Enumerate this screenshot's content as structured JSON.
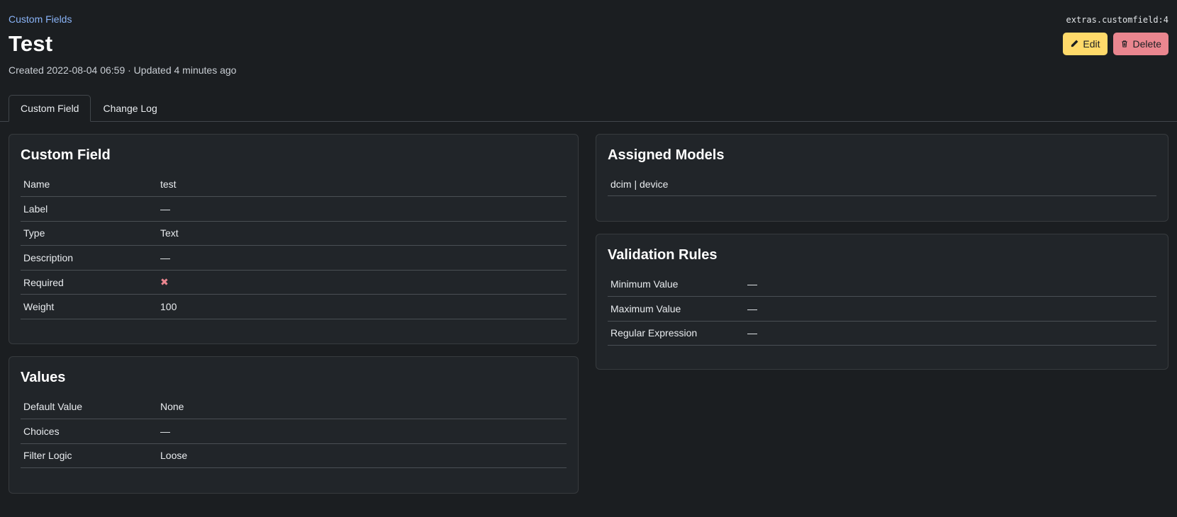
{
  "breadcrumb": "Custom Fields",
  "title": "Test",
  "meta": "Created 2022-08-04 06:59 · Updated 4 minutes ago",
  "object_id": "extras.customfield:4",
  "buttons": {
    "edit": "Edit",
    "delete": "Delete"
  },
  "tabs": [
    {
      "label": "Custom Field",
      "active": true
    },
    {
      "label": "Change Log",
      "active": false
    }
  ],
  "custom_field": {
    "title": "Custom Field",
    "rows": [
      {
        "key": "Name",
        "value": "test"
      },
      {
        "key": "Label",
        "value": "—"
      },
      {
        "key": "Type",
        "value": "Text"
      },
      {
        "key": "Description",
        "value": "—"
      },
      {
        "key": "Required",
        "value": "✖"
      },
      {
        "key": "Weight",
        "value": "100"
      }
    ]
  },
  "values": {
    "title": "Values",
    "rows": [
      {
        "key": "Default Value",
        "value": "None"
      },
      {
        "key": "Choices",
        "value": "—"
      },
      {
        "key": "Filter Logic",
        "value": "Loose"
      }
    ]
  },
  "assigned_models": {
    "title": "Assigned Models",
    "items": [
      "dcim | device"
    ]
  },
  "validation_rules": {
    "title": "Validation Rules",
    "rows": [
      {
        "key": "Minimum Value",
        "value": "—"
      },
      {
        "key": "Maximum Value",
        "value": "—"
      },
      {
        "key": "Regular Expression",
        "value": "—"
      }
    ]
  },
  "colors": {
    "edit": "#ffda6a",
    "delete": "#ea868f",
    "link": "#8ab4f8",
    "false_icon": "#ea868f"
  }
}
